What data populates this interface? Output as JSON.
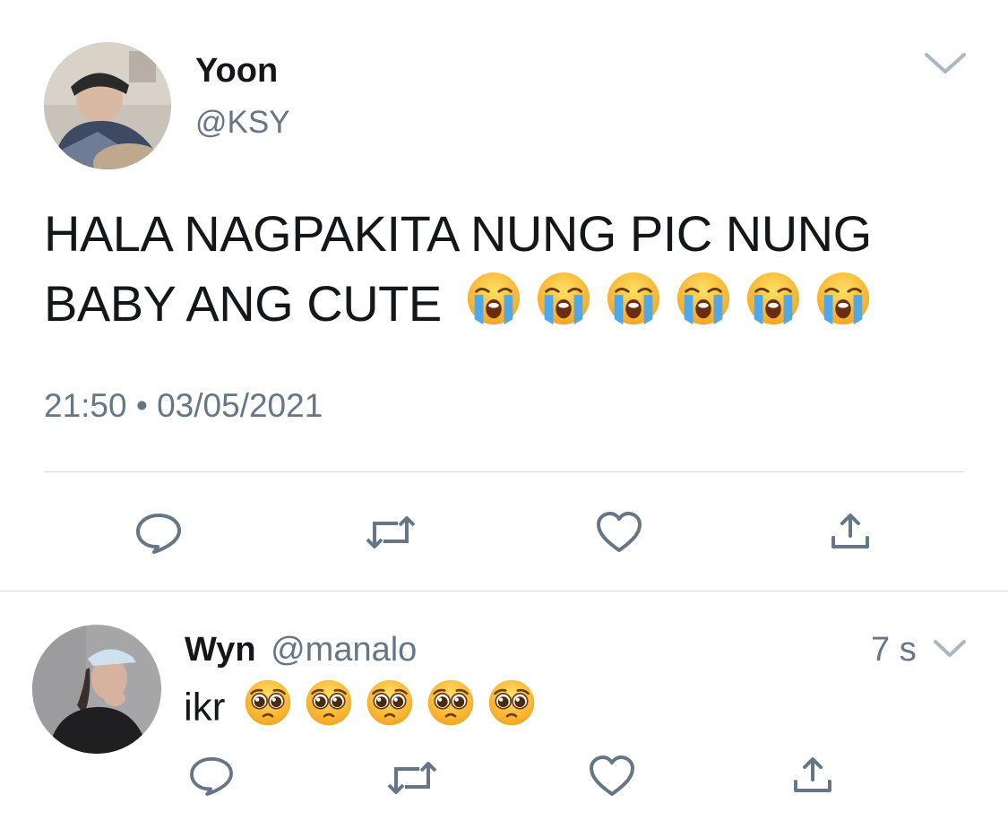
{
  "main_tweet": {
    "display_name": "Yoon",
    "handle": "@KSY",
    "text_line1": "HALA NAGPAKITA NUNG PIC NUNG",
    "text_line2": "BABY ANG CUTE",
    "emoji": "loudly-crying-face",
    "emoji_count": 6,
    "timestamp": "21:50 • 03/05/2021",
    "actions": [
      "reply-icon",
      "retweet-icon",
      "like-icon",
      "share-icon"
    ]
  },
  "reply": {
    "display_name": "Wyn",
    "handle": "@manalo",
    "age": "7 s",
    "text": "ikr",
    "emoji": "pleading-face",
    "emoji_count": 5,
    "actions": [
      "reply-icon",
      "retweet-icon",
      "like-icon",
      "share-icon"
    ]
  },
  "colors": {
    "text": "#14171a",
    "secondary": "#657786",
    "divider": "#d4d8db",
    "icon": "#657786"
  }
}
